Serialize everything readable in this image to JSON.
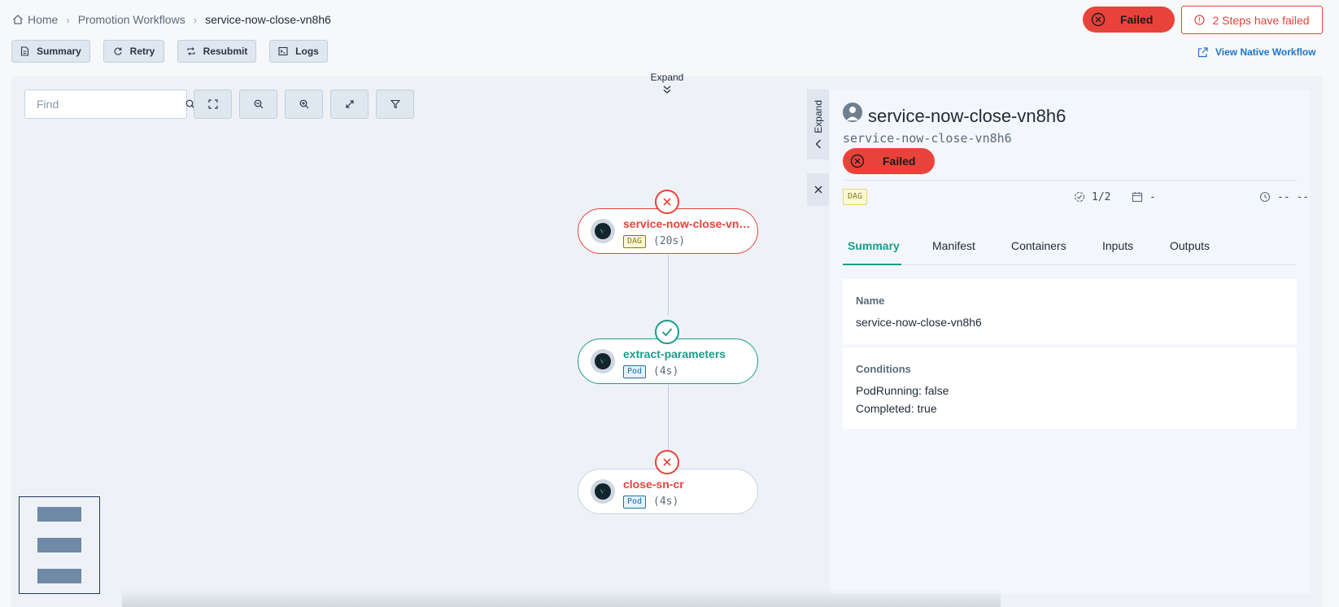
{
  "breadcrumb": {
    "home": "Home",
    "section": "Promotion Workflows",
    "current": "service-now-close-vn8h6"
  },
  "header": {
    "status": "Failed",
    "steps_failed": "2 Steps have failed",
    "native_link": "View Native Workflow"
  },
  "toolbar": {
    "summary": "Summary",
    "retry": "Retry",
    "resubmit": "Resubmit",
    "logs": "Logs"
  },
  "canvas": {
    "expand_label": "Expand",
    "find_placeholder": "Find"
  },
  "graph": {
    "nodes": [
      {
        "title": "service-now-close-vn8...",
        "type": "DAG",
        "duration": "(20s)",
        "status": "failed"
      },
      {
        "title": "extract-parameters",
        "type": "Pod",
        "duration": "(4s)",
        "status": "succeeded"
      },
      {
        "title": "close-sn-cr",
        "type": "Pod",
        "duration": "(4s)",
        "status": "failed"
      }
    ]
  },
  "panel": {
    "expand_label": "Expand",
    "title": "service-now-close-vn8h6",
    "subtitle": "service-now-close-vn8h6",
    "status": "Failed",
    "type_badge": "DAG",
    "progress": "1/2",
    "date": "-",
    "duration": "-- --",
    "tabs": [
      "Summary",
      "Manifest",
      "Containers",
      "Inputs",
      "Outputs"
    ],
    "active_tab": "Summary",
    "name_label": "Name",
    "name_value": "service-now-close-vn8h6",
    "conditions_label": "Conditions",
    "conditions": [
      "PodRunning: false",
      "Completed: true"
    ]
  },
  "colors": {
    "failed": "#e9423a",
    "succeeded": "#1a9c8c",
    "link": "#1f74c6",
    "canvas_bg": "#eef2f7"
  },
  "icons": [
    "home-icon",
    "x-circle-icon",
    "alert-circle-icon",
    "document-icon",
    "retry-icon",
    "resubmit-icon",
    "terminal-icon",
    "external-link-icon",
    "chevron-double-down-icon",
    "search-icon",
    "fit-screen-icon",
    "zoom-out-icon",
    "zoom-in-icon",
    "expand-arrows-icon",
    "filter-icon",
    "argo-icon",
    "check-icon",
    "close-icon",
    "chevron-left-icon",
    "user-icon",
    "progress-check-icon",
    "calendar-icon",
    "clock-icon"
  ]
}
